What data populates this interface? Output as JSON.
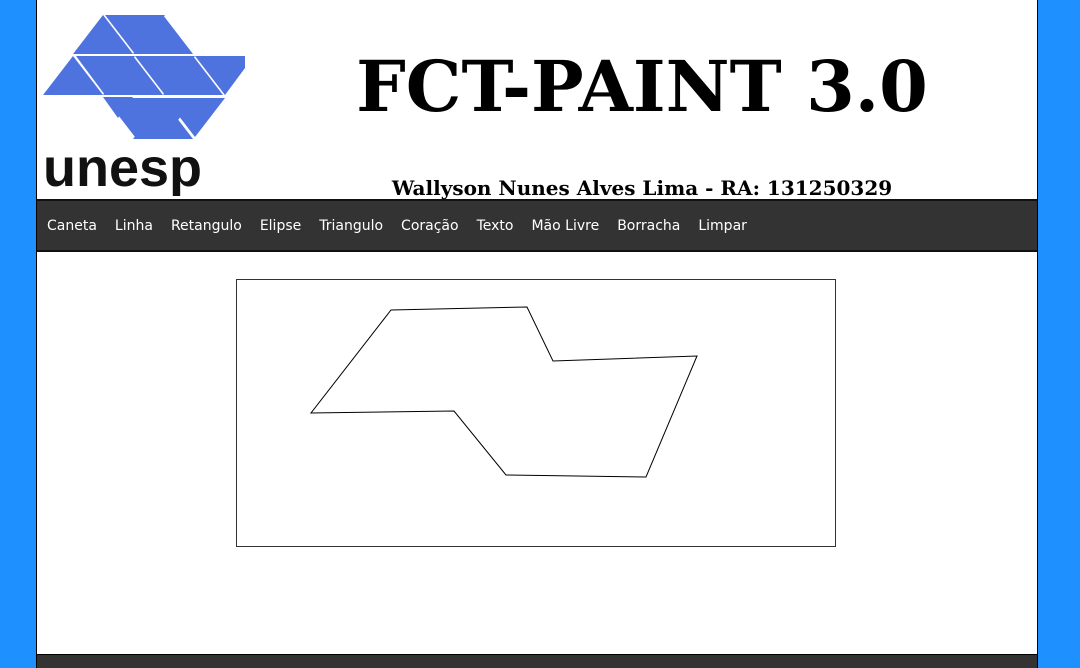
{
  "header": {
    "logo_text": "unesp",
    "logo_color": "#4e73df",
    "title": "FCT-PAINT 3.0",
    "author": "Wallyson Nunes Alves Lima - RA: 131250329"
  },
  "toolbar": {
    "tools": [
      "Caneta",
      "Linha",
      "Retangulo",
      "Elipse",
      "Triangulo",
      "Coração",
      "Texto",
      "Mão Livre",
      "Borracha",
      "Limpar"
    ]
  },
  "colors": {
    "page_background": "#1e90ff",
    "toolbar_background": "#333333",
    "toolbar_text": "#ffffff",
    "stroke": "#000000"
  }
}
